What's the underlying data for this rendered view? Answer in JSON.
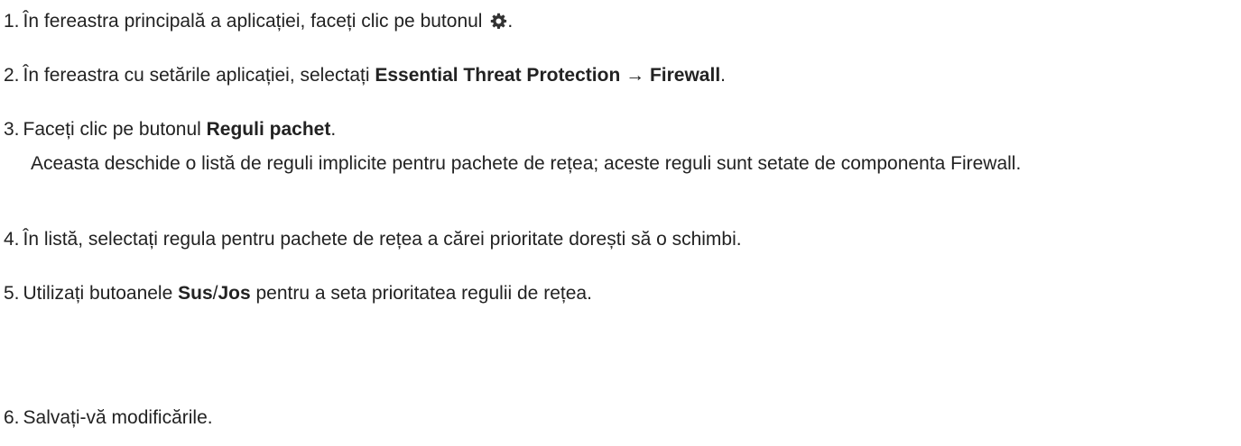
{
  "steps": [
    {
      "number": "1.",
      "text_before": "În fereastra principală a aplicației, faceți clic pe butonul ",
      "icon": "gear-icon",
      "text_after": "."
    },
    {
      "number": "2.",
      "text_before": "În fereastra cu setările aplicației, selectați ",
      "bold1": "Essential Threat Protection",
      "arrow": " → ",
      "bold2": "Firewall",
      "text_after": "."
    },
    {
      "number": "3.",
      "text_before": "Faceți clic pe butonul ",
      "bold1": "Reguli pachet",
      "text_after": ".",
      "note": "Aceasta deschide o listă de reguli implicite pentru pachete de rețea; aceste reguli sunt setate de componenta Firewall."
    },
    {
      "number": "4.",
      "text": "În listă, selectați regula pentru pachete de rețea a cărei prioritate dorești să o schimbi."
    },
    {
      "number": "5.",
      "text_before": "Utilizați butoanele ",
      "bold1": "Sus",
      "sep": "/",
      "bold2": "Jos",
      "text_after": " pentru a seta prioritatea regulii de rețea."
    },
    {
      "number": "6.",
      "text": "Salvați-vă modificările."
    }
  ],
  "colors": {
    "text": "#222222",
    "icon": "#333333"
  }
}
